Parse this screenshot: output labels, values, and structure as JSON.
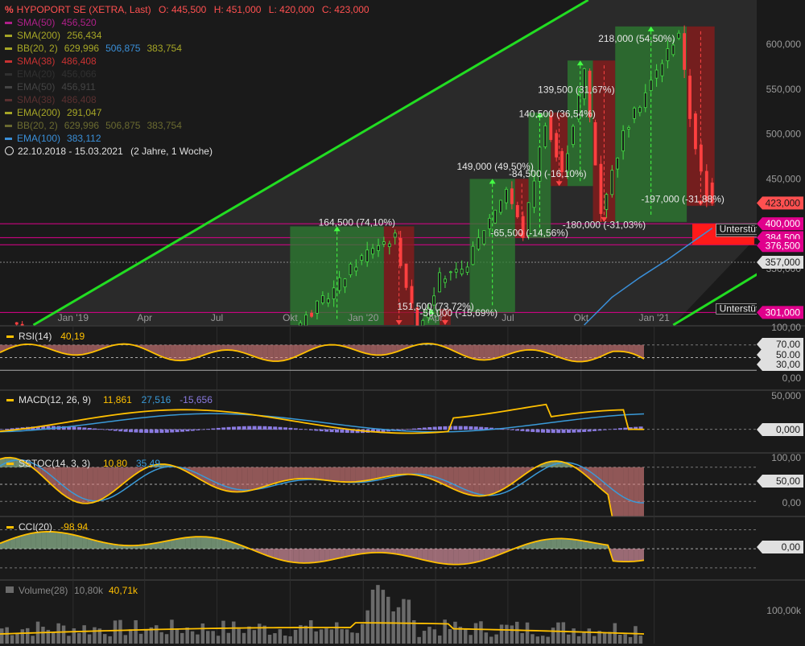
{
  "header": {
    "icon": "percent-icon",
    "symbol": "HYPOPORT SE (XETRA, Last)",
    "ohlc": [
      {
        "label": "O:",
        "value": "445,500"
      },
      {
        "label": "H:",
        "value": "451,000"
      },
      {
        "label": "L:",
        "value": "420,000"
      },
      {
        "label": "C:",
        "value": "423,000"
      }
    ],
    "period": "22.10.2018 - 15.03.2021",
    "period_note": "(2 Jahre, 1 Woche)",
    "clock_icon": "clock-icon"
  },
  "indicators": [
    {
      "label": "SMA(50)",
      "values": [
        "456,520"
      ],
      "color": "#b0208a"
    },
    {
      "label": "SMA(200)",
      "values": [
        "256,434"
      ],
      "color": "#a6a626"
    },
    {
      "label": "BB(20, 2)",
      "values": [
        "629,996",
        "506,875",
        "383,754"
      ],
      "color": "#a6a626",
      "value_colors": [
        "#a6a626",
        "#3a8fd8",
        "#a6a626"
      ]
    },
    {
      "label": "SMA(38)",
      "values": [
        "486,408"
      ],
      "color": "#c83232"
    },
    {
      "label": "EMA(20)",
      "values": [
        "456,066"
      ],
      "color": "#303030"
    },
    {
      "label": "EMA(50)",
      "values": [
        "456,911"
      ],
      "color": "#444444"
    },
    {
      "label": "SMA(38)",
      "values": [
        "486,408"
      ],
      "color": "#5a3030"
    },
    {
      "label": "EMA(200)",
      "values": [
        "291,047"
      ],
      "color": "#a6a626"
    },
    {
      "label": "BB(20, 2)",
      "values": [
        "629,996",
        "506,875",
        "383,754"
      ],
      "color": "#6a6a30",
      "value_colors": [
        "#6a6a30",
        "#6a6a30",
        "#6a6a30"
      ]
    },
    {
      "label": "EMA(100)",
      "values": [
        "383,112"
      ],
      "color": "#3a8fd8"
    }
  ],
  "x_axis": {
    "labels": [
      "Jan '19",
      "Apr",
      "Jul",
      "Okt",
      "Jan '20",
      "Apr",
      "Jul",
      "Okt",
      "Jan '21"
    ]
  },
  "price_axis": {
    "ticks": [
      "600,000",
      "550,000",
      "500,000",
      "450,000",
      "350,000"
    ],
    "markers": [
      {
        "text": "423,000",
        "bg": "#ff5050",
        "color": "#1a1a1a"
      },
      {
        "text": "400,000",
        "bg": "#e0008c",
        "color": "#ffffff"
      },
      {
        "text": "384,500",
        "bg": "#e0008c",
        "color": "#ffffff"
      },
      {
        "text": "376,500",
        "bg": "#e0008c",
        "color": "#ffffff"
      },
      {
        "text": "357,000",
        "bg": "#e0e0e0",
        "color": "#1a1a1a"
      },
      {
        "text": "301,000",
        "bg": "#e0008c",
        "color": "#ffffff"
      }
    ]
  },
  "support_labels": [
    "Unterstützung",
    "Unterstützung",
    "Unterstützung"
  ],
  "annotations": [
    "218,000 (54,50%)",
    "139,500 (31,67%)",
    "140,500 (36,54%)",
    "149,000 (49,50%)",
    "164,500 (74,10%)",
    "151,500 (73,72%)",
    "-84,500 (-16,10%)",
    "-197,000 (-31,88%)",
    "-180,000 (-31,03%)",
    "-65,500 (-14,56%)",
    "-56,000 (-15,69%)"
  ],
  "rsi": {
    "label": "RSI(14)",
    "value": "40,19",
    "ticks": [
      "100,00",
      "70,00",
      "50,00",
      "30,00",
      "0,00"
    ]
  },
  "macd": {
    "label": "MACD(12, 26, 9)",
    "values": [
      "11,861",
      "27,516",
      "-15,656"
    ],
    "ticks": [
      "50,000",
      "0,000"
    ]
  },
  "sstoc": {
    "label": "SSTOC(14, 3, 3)",
    "values": [
      "10,80",
      "35,49"
    ],
    "ticks": [
      "100,00",
      "50,00",
      "0,00"
    ]
  },
  "cci": {
    "label": "CCI(20)",
    "value": "-98,94",
    "ticks": [
      "0,00"
    ]
  },
  "volume": {
    "icon": "bars-icon",
    "label": "Volume(28)",
    "values": [
      "10,80k",
      "40,71k"
    ],
    "ticks": [
      "100,00k"
    ]
  },
  "colors": {
    "background": "#1a1a1a",
    "up_zone": "#2e7d32",
    "down_zone": "#8e1b1b",
    "trend": "#22dd22",
    "support": "#e0008c",
    "osc": "#ffc000",
    "signal": "#3a9ad8",
    "hist": "#8a7ae0"
  },
  "chart_data": {
    "type": "candlestick",
    "title": "HYPOPORT SE (XETRA, Last)",
    "x_range": [
      "2018-10-22",
      "2021-03-15"
    ],
    "y_visible_range": [
      292,
      625
    ],
    "last": {
      "open": 445.5,
      "high": 451.0,
      "low": 420.0,
      "close": 423.0
    },
    "support_levels": [
      400.0,
      384.5,
      376.5,
      301.0
    ],
    "reference_level": 357.0,
    "moves": [
      {
        "label": "164,500 (74,10%)",
        "change": 164.5,
        "pct": 74.1
      },
      {
        "label": "151,500 (73,72%)",
        "change": 151.5,
        "pct": 73.72
      },
      {
        "label": "149,000 (49,50%)",
        "change": 149.0,
        "pct": 49.5
      },
      {
        "label": "140,500 (36,54%)",
        "change": 140.5,
        "pct": 36.54
      },
      {
        "label": "139,500 (31,67%)",
        "change": 139.5,
        "pct": 31.67
      },
      {
        "label": "218,000 (54,50%)",
        "change": 218.0,
        "pct": 54.5
      },
      {
        "label": "-56,000 (-15,69%)",
        "change": -56.0,
        "pct": -15.69
      },
      {
        "label": "-65,500 (-14,56%)",
        "change": -65.5,
        "pct": -14.56
      },
      {
        "label": "-84,500 (-16,10%)",
        "change": -84.5,
        "pct": -16.1
      },
      {
        "label": "-180,000 (-31,03%)",
        "change": -180.0,
        "pct": -31.03
      },
      {
        "label": "-197,000 (-31,88%)",
        "change": -197.0,
        "pct": -31.88
      }
    ],
    "indicators_last": {
      "RSI(14)": 40.19,
      "MACD(12, 26, 9)": [
        11.861,
        27.516,
        -15.656
      ],
      "SSTOC(14, 3, 3)": [
        10.8,
        35.49
      ],
      "CCI(20)": -98.94,
      "Volume(28)": [
        "10,80k",
        "40,71k"
      ]
    }
  }
}
